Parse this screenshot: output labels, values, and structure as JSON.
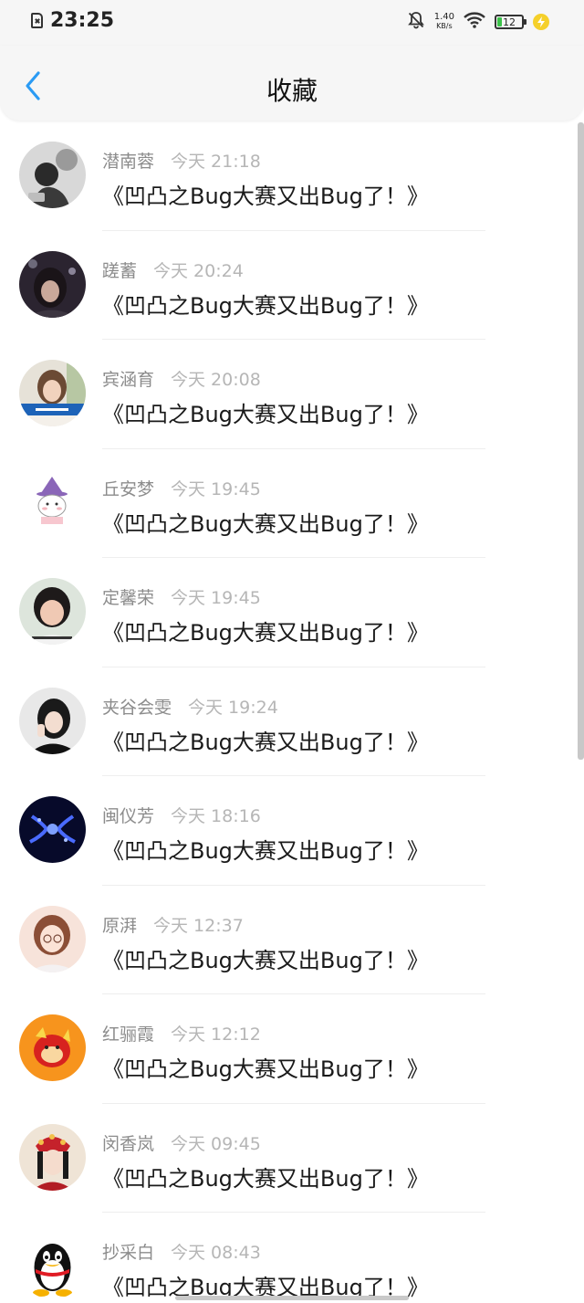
{
  "status_bar": {
    "time": "23:25",
    "net_speed_value": "1.40",
    "net_speed_unit": "KB/s",
    "battery": "12",
    "icons": [
      "sim-missing-icon",
      "bell-off-icon",
      "wifi-icon",
      "battery-icon",
      "charging-icon"
    ]
  },
  "header": {
    "title": "收藏",
    "back_icon": "chevron-left-icon"
  },
  "colors": {
    "accent": "#2b9bf4",
    "name_text": "#8c8c8c",
    "time_text": "#b6b6b6",
    "header_bg": "#f6f6f6"
  },
  "favorites": [
    {
      "name": "潜南蓉",
      "time": "今天 21:18",
      "text": "《凹凸之Bug大赛又出Bug了！》"
    },
    {
      "name": "蹉蓄",
      "time": "今天 20:24",
      "text": "《凹凸之Bug大赛又出Bug了！》"
    },
    {
      "name": "宾涵育",
      "time": "今天 20:08",
      "text": "《凹凸之Bug大赛又出Bug了！》"
    },
    {
      "name": "丘安梦",
      "time": "今天 19:45",
      "text": "《凹凸之Bug大赛又出Bug了！》"
    },
    {
      "name": "定馨荣",
      "time": "今天 19:45",
      "text": "《凹凸之Bug大赛又出Bug了！》"
    },
    {
      "name": "夹谷会雯",
      "time": "今天 19:24",
      "text": "《凹凸之Bug大赛又出Bug了！》"
    },
    {
      "name": "闽仪芳",
      "time": "今天 18:16",
      "text": "《凹凸之Bug大赛又出Bug了！》"
    },
    {
      "name": "原湃",
      "time": "今天 12:37",
      "text": "《凹凸之Bug大赛又出Bug了！》"
    },
    {
      "name": "红骊霞",
      "time": "今天 12:12",
      "text": "《凹凸之Bug大赛又出Bug了！》"
    },
    {
      "name": "闵香岚",
      "time": "今天 09:45",
      "text": "《凹凸之Bug大赛又出Bug了！》"
    },
    {
      "name": "抄采白",
      "time": "今天 08:43",
      "text": "《凹凸之Bug大赛又出Bug了！》"
    }
  ]
}
